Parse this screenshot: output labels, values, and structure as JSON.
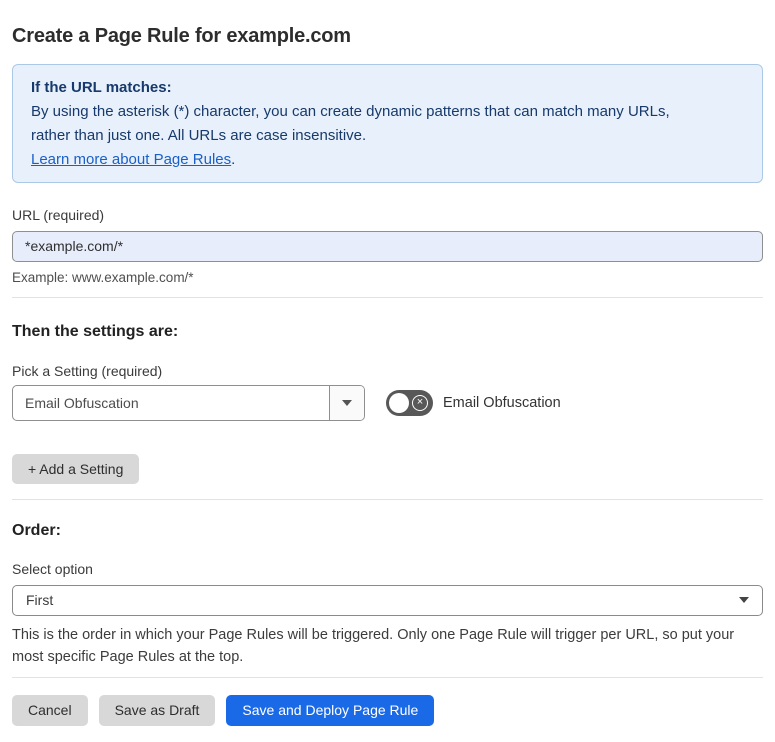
{
  "page": {
    "title": "Create a Page Rule for example.com"
  },
  "info_box": {
    "heading": "If the URL matches:",
    "body_lines": [
      "By using the asterisk (*) character, you can create dynamic patterns that can match many URLs,",
      "rather than just one. All URLs are case insensitive."
    ],
    "link_label": "Learn more about Page Rules",
    "link_suffix": "."
  },
  "url_field": {
    "label": "URL (required)",
    "value": "*example.com/*",
    "helper": "Example: www.example.com/*"
  },
  "settings_section": {
    "heading": "Then the settings are:",
    "picker_label": "Pick a Setting (required)",
    "picker_value": "Email Obfuscation",
    "toggle_state": "off",
    "toggle_off_glyph": "×",
    "toggle_label": "Email Obfuscation",
    "add_setting_label": "+ Add a Setting"
  },
  "order_section": {
    "heading": "Order:",
    "select_label": "Select option",
    "select_value": "First",
    "helper_lines": [
      "This is the order in which your Page Rules will be triggered. Only one Page Rule will trigger per URL, so put your",
      "most specific Page Rules at the top."
    ]
  },
  "footer": {
    "cancel_label": "Cancel",
    "save_draft_label": "Save as Draft",
    "save_deploy_label": "Save and Deploy Page Rule"
  },
  "colors": {
    "primary_button_blue": "#1a6ae8",
    "info_box_background": "#e8f1fb",
    "info_box_border": "#abc9e6",
    "info_box_text": "#17396b",
    "link_blue": "#1a5fc8",
    "url_input_background": "#e7edfb",
    "gray_button_background": "#d8d8d8",
    "toggle_off_background": "#585858"
  }
}
